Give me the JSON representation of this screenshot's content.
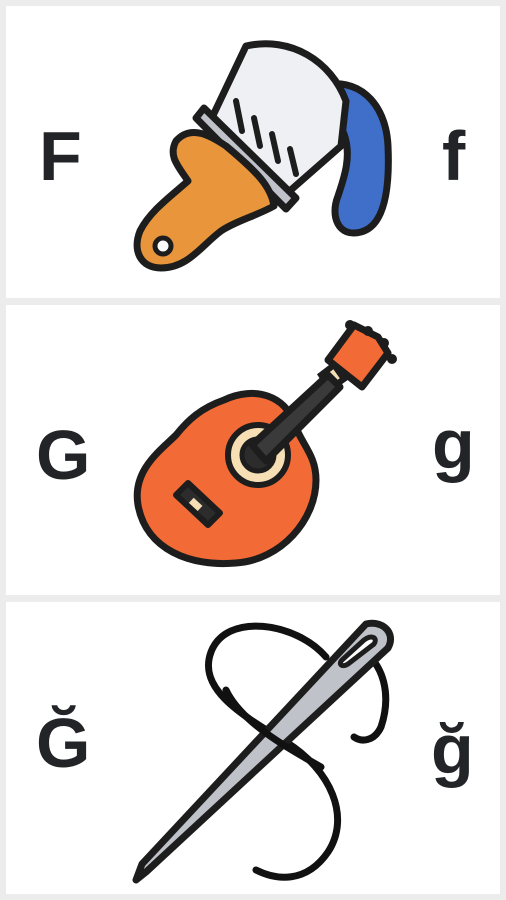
{
  "cards": [
    {
      "upper": "F",
      "lower": "f",
      "icon": "paintbrush-icon",
      "colors": {
        "handle": "#e8953b",
        "bristles": "#eef0f4",
        "paint": "#3f6fc8",
        "outline": "#1d1d1d"
      }
    },
    {
      "upper": "G",
      "lower": "g",
      "icon": "guitar-icon",
      "colors": {
        "body": "#f26a35",
        "neck": "#3a3a3a",
        "soundhole_ring": "#f6dfb4",
        "outline": "#1d1d1d"
      }
    },
    {
      "upper": "Ğ",
      "lower": "ğ",
      "icon": "needle-thread-icon",
      "colors": {
        "needle": "#bfc3c9",
        "thread": "#111111",
        "outline": "#1d1d1d"
      }
    }
  ]
}
